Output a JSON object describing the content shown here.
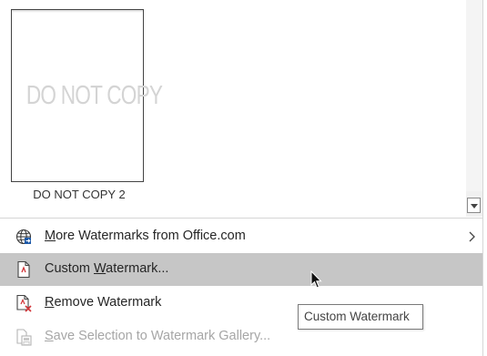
{
  "gallery": {
    "items": [
      {
        "preview_text": "DO NOT COPY",
        "caption": "DO NOT COPY 2"
      }
    ]
  },
  "menu": {
    "items": [
      {
        "id": "more",
        "prefix": "",
        "accel": "M",
        "rest": "ore Watermarks from Office.com",
        "icon": "globe-icon",
        "has_submenu": true,
        "state": "normal"
      },
      {
        "id": "custom",
        "prefix": "Custom ",
        "accel": "W",
        "rest": "atermark...",
        "icon": "custom-watermark-icon",
        "has_submenu": false,
        "state": "hover"
      },
      {
        "id": "remove",
        "prefix": "",
        "accel": "R",
        "rest": "emove Watermark",
        "icon": "remove-watermark-icon",
        "has_submenu": false,
        "state": "normal"
      },
      {
        "id": "save",
        "prefix": "",
        "accel": "S",
        "rest": "ave Selection to Watermark Gallery...",
        "icon": "save-selection-icon",
        "has_submenu": false,
        "state": "disabled"
      }
    ]
  },
  "tooltip": {
    "text": "Custom Watermark"
  },
  "colors": {
    "hover": "#c6c6c6",
    "disabled_text": "#a6a6a6",
    "accent_red": "#d13438",
    "globe_blue": "#1e5aa8"
  }
}
